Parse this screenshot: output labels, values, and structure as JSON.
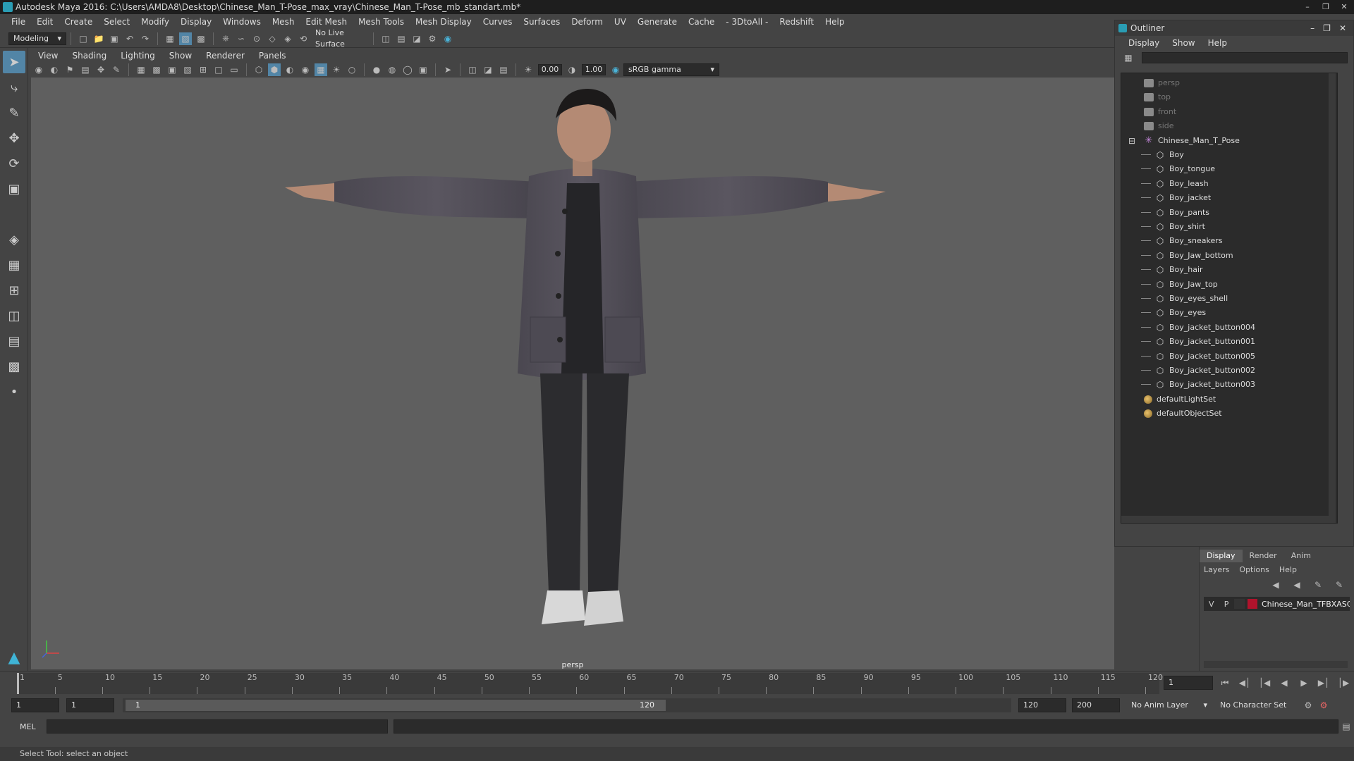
{
  "window": {
    "title": "Autodesk Maya 2016: C:\\Users\\AMDA8\\Desktop\\Chinese_Man_T-Pose_max_vray\\Chinese_Man_T-Pose_mb_standart.mb*"
  },
  "menubar": [
    "File",
    "Edit",
    "Create",
    "Select",
    "Modify",
    "Display",
    "Windows",
    "Mesh",
    "Edit Mesh",
    "Mesh Tools",
    "Mesh Display",
    "Curves",
    "Surfaces",
    "Deform",
    "UV",
    "Generate",
    "Cache",
    "- 3DtoAll -",
    "Redshift",
    "Help"
  ],
  "shelf": {
    "mode": "Modeling",
    "live_surface": "No Live Surface"
  },
  "panel_menu": [
    "View",
    "Shading",
    "Lighting",
    "Show",
    "Renderer",
    "Panels"
  ],
  "panel_tools": {
    "exposure": "0.00",
    "gamma": "1.00",
    "color_space": "sRGB gamma"
  },
  "viewport": {
    "camera_label": "persp"
  },
  "outliner": {
    "title": "Outliner",
    "menu": [
      "Display",
      "Show",
      "Help"
    ],
    "search_value": "",
    "items": [
      {
        "label": "persp",
        "type": "camera",
        "indent": 2,
        "dim": true
      },
      {
        "label": "top",
        "type": "camera",
        "indent": 2,
        "dim": true
      },
      {
        "label": "front",
        "type": "camera",
        "indent": 2,
        "dim": true
      },
      {
        "label": "side",
        "type": "camera",
        "indent": 2,
        "dim": true
      },
      {
        "label": "Chinese_Man_T_Pose",
        "type": "transform",
        "indent": 2,
        "expanded": true
      },
      {
        "label": "Boy",
        "type": "mesh",
        "indent": 3
      },
      {
        "label": "Boy_tongue",
        "type": "mesh",
        "indent": 3
      },
      {
        "label": "Boy_leash",
        "type": "mesh",
        "indent": 3
      },
      {
        "label": "Boy_jacket",
        "type": "mesh",
        "indent": 3
      },
      {
        "label": "Boy_pants",
        "type": "mesh",
        "indent": 3
      },
      {
        "label": "Boy_shirt",
        "type": "mesh",
        "indent": 3
      },
      {
        "label": "Boy_sneakers",
        "type": "mesh",
        "indent": 3
      },
      {
        "label": "Boy_Jaw_bottom",
        "type": "mesh",
        "indent": 3
      },
      {
        "label": "Boy_hair",
        "type": "mesh",
        "indent": 3
      },
      {
        "label": "Boy_Jaw_top",
        "type": "mesh",
        "indent": 3
      },
      {
        "label": "Boy_eyes_shell",
        "type": "mesh",
        "indent": 3
      },
      {
        "label": "Boy_eyes",
        "type": "mesh",
        "indent": 3
      },
      {
        "label": "Boy_jacket_button004",
        "type": "mesh",
        "indent": 3
      },
      {
        "label": "Boy_jacket_button001",
        "type": "mesh",
        "indent": 3
      },
      {
        "label": "Boy_jacket_button005",
        "type": "mesh",
        "indent": 3
      },
      {
        "label": "Boy_jacket_button002",
        "type": "mesh",
        "indent": 3
      },
      {
        "label": "Boy_jacket_button003",
        "type": "mesh",
        "indent": 3
      },
      {
        "label": "defaultLightSet",
        "type": "set",
        "indent": 2
      },
      {
        "label": "defaultObjectSet",
        "type": "set",
        "indent": 2
      }
    ]
  },
  "layer_editor": {
    "tabs": [
      "Display",
      "Render",
      "Anim"
    ],
    "active_tab": "Display",
    "menu": [
      "Layers",
      "Options",
      "Help"
    ],
    "layer": {
      "v": "V",
      "p": "P",
      "name": "Chinese_Man_TFBXASC",
      "color": "#b0132c"
    }
  },
  "timeline": {
    "ticks": [
      "1",
      "5",
      "10",
      "15",
      "20",
      "25",
      "30",
      "35",
      "40",
      "45",
      "50",
      "55",
      "60",
      "65",
      "70",
      "75",
      "80",
      "85",
      "90",
      "95",
      "100",
      "105",
      "110",
      "115",
      "120"
    ],
    "current_frame": "1"
  },
  "range": {
    "start": "1",
    "playback_start": "1",
    "slider_start": "1",
    "slider_end": "120",
    "playback_end": "120",
    "end": "200",
    "anim_layer": "No Anim Layer",
    "character_set": "No Character Set"
  },
  "cmdline": {
    "label": "MEL",
    "value": ""
  },
  "helpline": "Select Tool: select an object"
}
